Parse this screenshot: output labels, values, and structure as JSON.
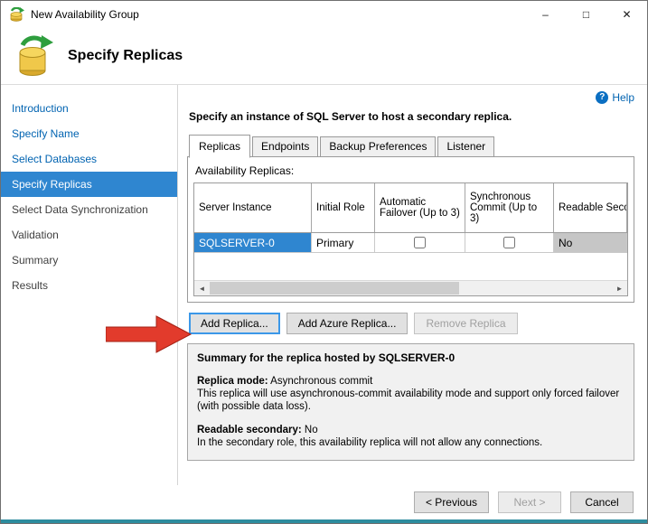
{
  "window": {
    "title": "New Availability Group"
  },
  "icons": {
    "help_glyph": "?",
    "minimize_glyph": "–",
    "maximize_glyph": "□",
    "close_glyph": "✕",
    "scroll_left_glyph": "◄",
    "scroll_right_glyph": "►"
  },
  "header": {
    "title": "Specify Replicas"
  },
  "sidebar": {
    "items": [
      {
        "label": "Introduction",
        "state": "completed"
      },
      {
        "label": "Specify Name",
        "state": "completed"
      },
      {
        "label": "Select Databases",
        "state": "completed"
      },
      {
        "label": "Specify Replicas",
        "state": "active"
      },
      {
        "label": "Select Data Synchronization",
        "state": "upcoming"
      },
      {
        "label": "Validation",
        "state": "upcoming"
      },
      {
        "label": "Summary",
        "state": "upcoming"
      },
      {
        "label": "Results",
        "state": "upcoming"
      }
    ]
  },
  "main": {
    "help_label": "Help",
    "instruction": "Specify an instance of SQL Server to host a secondary replica.",
    "tabs": [
      {
        "label": "Replicas",
        "active": true
      },
      {
        "label": "Endpoints",
        "active": false
      },
      {
        "label": "Backup Preferences",
        "active": false
      },
      {
        "label": "Listener",
        "active": false
      }
    ],
    "replicas_label": "Availability Replicas:",
    "table": {
      "columns": [
        "Server Instance",
        "Initial Role",
        "Automatic Failover (Up to 3)",
        "Synchronous Commit (Up to 3)",
        "Readable Seco"
      ],
      "rows": [
        {
          "server_instance": "SQLSERVER-0",
          "initial_role": "Primary",
          "automatic_failover_checked": false,
          "synchronous_commit_checked": false,
          "readable_secondary": "No"
        }
      ]
    },
    "actions": {
      "add_replica": "Add Replica...",
      "add_azure_replica": "Add Azure Replica...",
      "remove_replica": "Remove Replica"
    },
    "summary": {
      "title": "Summary for the replica hosted by SQLSERVER-0",
      "replica_mode_label": "Replica mode:",
      "replica_mode_value": "Asynchronous commit",
      "replica_mode_description": "This replica will use asynchronous-commit availability mode and support only forced failover (with possible data loss).",
      "readable_secondary_label": "Readable secondary:",
      "readable_secondary_value": "No",
      "readable_secondary_description": "In the secondary role, this availability replica will not allow any connections."
    }
  },
  "footer": {
    "previous_label": "< Previous",
    "next_label": "Next >",
    "cancel_label": "Cancel"
  },
  "colors": {
    "accent_blue": "#2f86d0",
    "link_blue": "#0063b1",
    "arrow_red": "#e23b2c",
    "bottom_bar_teal": "#2d8c9e"
  }
}
